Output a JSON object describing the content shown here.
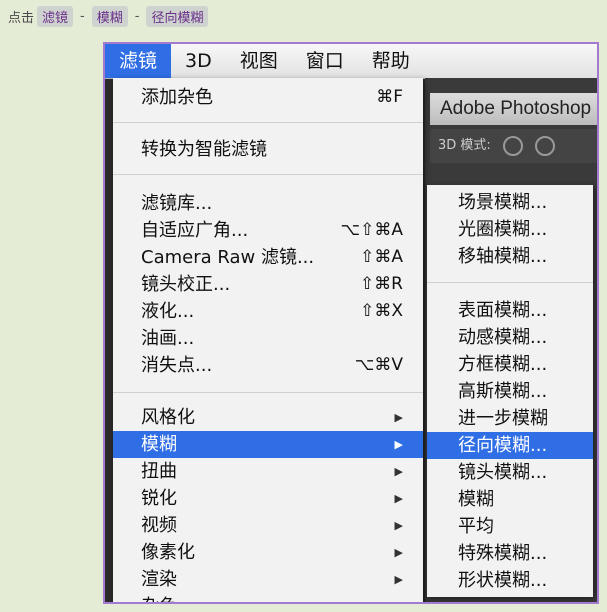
{
  "breadcrumb": {
    "prefix": "点击",
    "step1": "滤镜",
    "sep1": "-",
    "step2": "模糊",
    "sep2": "-",
    "step3": "径向模糊"
  },
  "menubar": {
    "items": [
      "滤镜",
      "3D",
      "视图",
      "窗口",
      "帮助"
    ],
    "active": "滤镜"
  },
  "photoshop": {
    "title": "Adobe Photoshop",
    "mode_label": "3D 模式:"
  },
  "filter_menu": {
    "items": [
      {
        "label": "添加杂色",
        "shortcut": "⌘F"
      },
      {
        "label": "转换为智能滤镜",
        "shortcut": ""
      },
      {
        "label": "滤镜库...",
        "shortcut": ""
      },
      {
        "label": "自适应广角...",
        "shortcut": "⌥⇧⌘A"
      },
      {
        "label": "Camera Raw 滤镜...",
        "shortcut": "⇧⌘A"
      },
      {
        "label": "镜头校正...",
        "shortcut": "⇧⌘R"
      },
      {
        "label": "液化...",
        "shortcut": "⇧⌘X"
      },
      {
        "label": "油画...",
        "shortcut": ""
      },
      {
        "label": "消失点...",
        "shortcut": "⌥⌘V"
      },
      {
        "label": "风格化",
        "arrow": "▶"
      },
      {
        "label": "模糊",
        "arrow": "▶"
      },
      {
        "label": "扭曲",
        "arrow": "▶"
      },
      {
        "label": "锐化",
        "arrow": "▶"
      },
      {
        "label": "视频",
        "arrow": "▶"
      },
      {
        "label": "像素化",
        "arrow": "▶"
      },
      {
        "label": "渲染",
        "arrow": "▶"
      },
      {
        "label": "杂色",
        "arrow": "▶"
      }
    ],
    "highlighted": "模糊"
  },
  "blur_submenu": {
    "items": [
      "场景模糊...",
      "光圈模糊...",
      "移轴模糊...",
      "表面模糊...",
      "动感模糊...",
      "方框模糊...",
      "高斯模糊...",
      "进一步模糊",
      "径向模糊...",
      "镜头模糊...",
      "模糊",
      "平均",
      "特殊模糊...",
      "形状模糊..."
    ],
    "highlighted": "径向模糊..."
  },
  "colors": {
    "highlight": "#2f6ee4",
    "frame_border": "#a47ad0",
    "page_bg": "#e4ecd5",
    "tag_text": "#6a2f8a"
  }
}
